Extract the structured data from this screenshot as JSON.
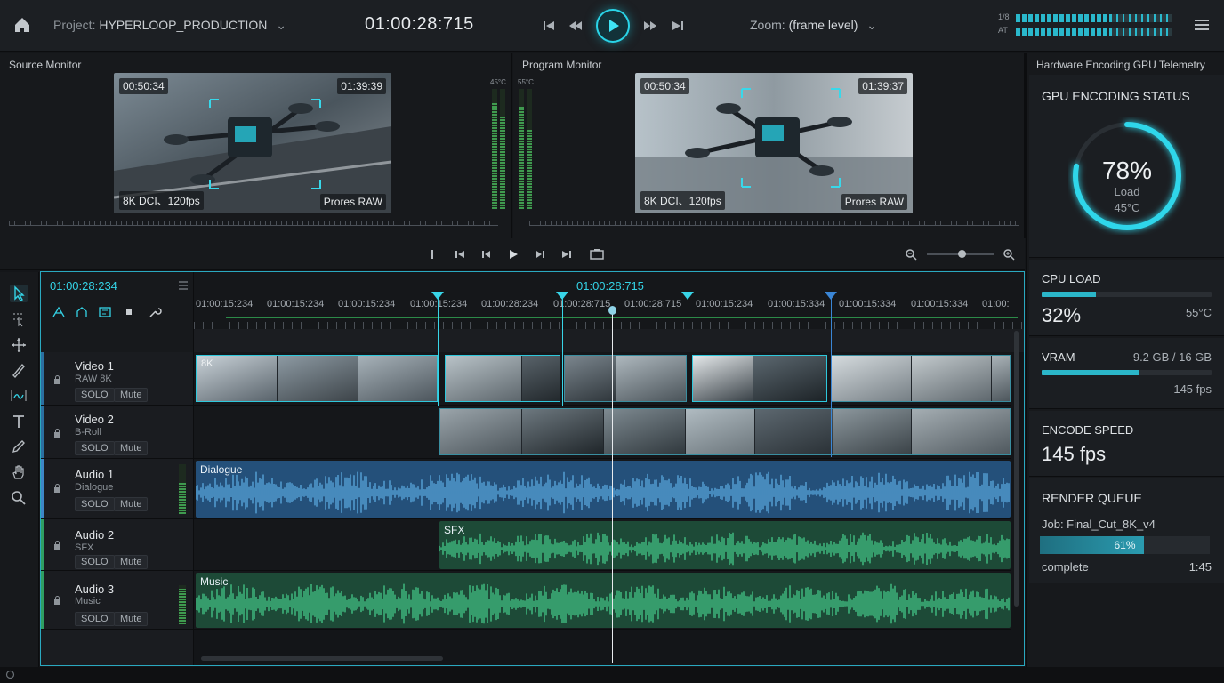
{
  "header": {
    "project_label": "Project:",
    "project_name": "HYPERLOOP_PRODUCTION",
    "timecode": "01:00:28:715",
    "zoom_label": "Zoom:",
    "zoom_value": "(frame level)",
    "meter_labels": [
      "1/8",
      "AT"
    ]
  },
  "source_monitor": {
    "title": "Source Monitor",
    "tc_in": "00:50:34",
    "tc_out": "01:39:39",
    "format": "8K DCI、120fps",
    "codec": "Prores RAW",
    "meter_label": "45°C"
  },
  "program_monitor": {
    "title": "Program Monitor",
    "tc_in": "00:50:34",
    "tc_out": "01:39:37",
    "format": "8K DCI、120fps",
    "codec": "Prores RAW",
    "meter_label": "55°C"
  },
  "timeline": {
    "head_timecode": "01:00:28:234",
    "ruler_timecode": "01:00:28:715",
    "ruler_labels": [
      "01:00:15:234",
      "01:00:15:234",
      "01:00:15:234",
      "01:00:15:234",
      "01:00:28:234",
      "01:00:28:715",
      "01:00:28:715",
      "01:00:15:234",
      "01:00:15:334",
      "01:00:15:334",
      "01:00:15:334",
      "01:00:"
    ],
    "tracks": [
      {
        "name": "Video 1",
        "sub": "RAW 8K",
        "solo": "SOLO",
        "mute": "Mute"
      },
      {
        "name": "Video 2",
        "sub": "B-Roll",
        "solo": "SOLO",
        "mute": "Mute"
      },
      {
        "name": "Audio 1",
        "sub": "Dialogue",
        "solo": "SOLO",
        "mute": "Mute"
      },
      {
        "name": "Audio 2",
        "sub": "SFX",
        "solo": "SOLO",
        "mute": "Mute"
      },
      {
        "name": "Audio 3",
        "sub": "Music",
        "solo": "SOLO",
        "mute": "Mute"
      }
    ],
    "clips": {
      "video1_label": "8K",
      "audio1_label": "Dialogue",
      "audio2_label": "SFX",
      "audio3_label": "Music"
    }
  },
  "telemetry": {
    "title": "Hardware Encoding GPU Telemetry",
    "gpu_title": "GPU ENCODING STATUS",
    "gpu_percent": "78%",
    "gpu_load_label": "Load",
    "gpu_temp": "45°C",
    "gpu_load_value": 0.78,
    "cpu_title": "CPU LOAD",
    "cpu_value": "32%",
    "cpu_fill": 0.32,
    "cpu_temp": "55°C",
    "vram_title": "VRAM",
    "vram_value": "9.2 GB / 16 GB",
    "vram_fill": 0.575,
    "vram_fps": "145 fps",
    "encode_title": "ENCODE SPEED",
    "encode_value": "145 fps",
    "queue_title": "RENDER QUEUE",
    "queue_job": "Job: Final_Cut_8K_v4",
    "queue_percent": "61%",
    "queue_fill": 0.61,
    "queue_status": "complete",
    "queue_time": "1:45"
  },
  "colors": {
    "accent": "#2ad4e8",
    "audio_blue": "#5aa9e0",
    "audio_green": "#45c98a"
  }
}
